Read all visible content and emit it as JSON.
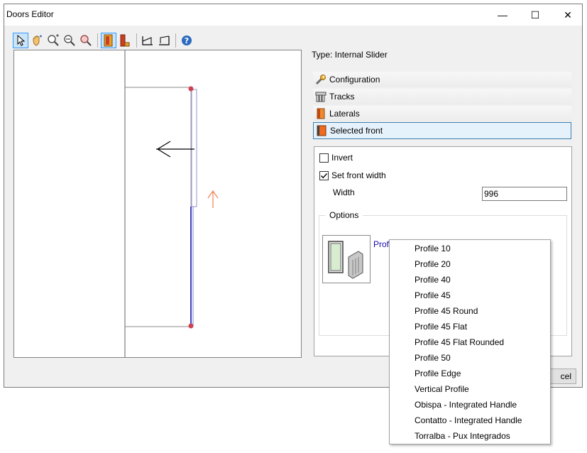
{
  "window": {
    "title": "Doors Editor",
    "minimize": "—",
    "maximize": "☐",
    "close": "✕"
  },
  "toolbar": {
    "icons": [
      "pointer-icon",
      "pan-hand-icon",
      "zoom-in-icon",
      "zoom-out-icon",
      "zoom-fit-icon",
      "front-view-icon",
      "side-view-icon",
      "perspective-left-icon",
      "perspective-right-icon",
      "help-icon"
    ],
    "selected": "front-view-icon"
  },
  "type_label": "Type: Internal Slider",
  "sections": [
    {
      "label": "Configuration",
      "icon": "wrench-icon"
    },
    {
      "label": "Tracks",
      "icon": "tracks-icon"
    },
    {
      "label": "Laterals",
      "icon": "laterals-icon"
    },
    {
      "label": "Selected front",
      "icon": "selected-front-icon"
    }
  ],
  "panel": {
    "invert_label": "Invert",
    "invert_checked": false,
    "set_front_width_label": "Set front width",
    "set_front_width_checked": true,
    "width_label": "Width",
    "width_value": "996",
    "options_label": "Options",
    "profile_link": "Profi"
  },
  "cancel_label": "cel",
  "dropdown_items": [
    "Profile 10",
    "Profile 20",
    "Profile 40",
    "Profile 45",
    "Profile 45 Round",
    "Profile 45 Flat",
    "Profile 45 Flat Rounded",
    "Profile 50",
    "Profile Edge",
    "Vertical Profile",
    "Obispa - Integrated Handle",
    "Contatto - Integrated Handle",
    "Torralba - Pux Integrados"
  ],
  "colors": {
    "accent": "#3c7fb1",
    "arrow": "#f08050",
    "pivot": "#d04050",
    "door_line": "#5050d0"
  }
}
